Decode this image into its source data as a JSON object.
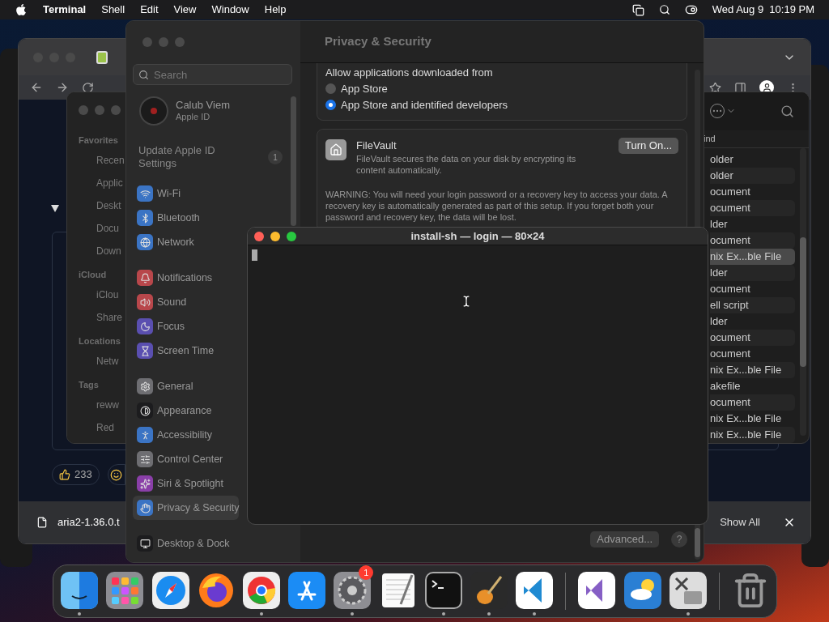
{
  "menu_bar": {
    "app": "Terminal",
    "menus": [
      "Shell",
      "Edit",
      "View",
      "Window",
      "Help"
    ],
    "clock": "Wed Aug 9  10:19 PM"
  },
  "browser": {
    "reaction_count": "233",
    "download": {
      "file": "aria2-1.36.0.t",
      "show_all": "Show All"
    }
  },
  "finder": {
    "sidebar": [
      {
        "kind": "heading",
        "label": "Favorites"
      },
      {
        "kind": "item",
        "label": "Recen"
      },
      {
        "kind": "item",
        "label": "Applic"
      },
      {
        "kind": "item",
        "label": "Deskt"
      },
      {
        "kind": "item",
        "label": "Docu"
      },
      {
        "kind": "item",
        "label": "Down"
      },
      {
        "kind": "heading",
        "label": "iCloud"
      },
      {
        "kind": "item",
        "label": "iClou"
      },
      {
        "kind": "item",
        "label": "Share"
      },
      {
        "kind": "heading",
        "label": "Locations"
      },
      {
        "kind": "item",
        "label": "Netw"
      },
      {
        "kind": "heading",
        "label": "Tags"
      },
      {
        "kind": "item",
        "label": "reww"
      },
      {
        "kind": "item",
        "label": "Red"
      }
    ],
    "column_header": "ind",
    "rows": [
      {
        "text": "older",
        "selected": false
      },
      {
        "text": "older",
        "selected": false
      },
      {
        "text": "ocument",
        "selected": false
      },
      {
        "text": "ocument",
        "selected": false
      },
      {
        "text": "lder",
        "selected": false
      },
      {
        "text": "ocument",
        "selected": false
      },
      {
        "text": "nix Ex...ble File",
        "selected": true
      },
      {
        "text": "lder",
        "selected": false
      },
      {
        "text": "ocument",
        "selected": false
      },
      {
        "text": "ell script",
        "selected": false
      },
      {
        "text": "lder",
        "selected": false
      },
      {
        "text": "ocument",
        "selected": false
      },
      {
        "text": "ocument",
        "selected": false
      },
      {
        "text": "nix Ex...ble File",
        "selected": false
      },
      {
        "text": "akefile",
        "selected": false
      },
      {
        "text": "ocument",
        "selected": false
      },
      {
        "text": "nix Ex...ble File",
        "selected": false
      },
      {
        "text": "nix Ex...ble File",
        "selected": false
      }
    ]
  },
  "settings": {
    "search": {
      "placeholder": "Search"
    },
    "account": {
      "name": "Calub Viem",
      "subtitle": "Apple ID"
    },
    "update": {
      "label": "Update Apple ID Settings",
      "badge": "1"
    },
    "groups": [
      [
        {
          "label": "Wi-Fi",
          "color": "#3b74c4",
          "selected": false
        },
        {
          "label": "Bluetooth",
          "color": "#3b74c4",
          "selected": false
        },
        {
          "label": "Network",
          "color": "#3b74c4",
          "selected": false
        }
      ],
      [
        {
          "label": "Notifications",
          "color": "#b8474b",
          "selected": false
        },
        {
          "label": "Sound",
          "color": "#b8474b",
          "selected": false
        },
        {
          "label": "Focus",
          "color": "#5a4fb0",
          "selected": false
        },
        {
          "label": "Screen Time",
          "color": "#5a4fb0",
          "selected": false
        }
      ],
      [
        {
          "label": "General",
          "color": "#6e6e72",
          "selected": false
        },
        {
          "label": "Appearance",
          "color": "#1c1c1e",
          "selected": false
        },
        {
          "label": "Accessibility",
          "color": "#3b74c4",
          "selected": false
        },
        {
          "label": "Control Center",
          "color": "#6e6e72",
          "selected": false
        },
        {
          "label": "Siri & Spotlight",
          "color": "#8a3fa8",
          "selected": false
        },
        {
          "label": "Privacy & Security",
          "color": "#3b74c4",
          "selected": true
        }
      ],
      [
        {
          "label": "Desktop & Dock",
          "color": "#1c1c1e",
          "selected": false
        }
      ]
    ],
    "title": "Privacy & Security",
    "allow": {
      "heading": "Allow applications downloaded from",
      "options": [
        {
          "label": "App Store",
          "selected": false
        },
        {
          "label": "App Store and identified developers",
          "selected": true
        }
      ]
    },
    "filevault": {
      "title": "FileVault",
      "description": "FileVault secures the data on your disk by encrypting its content automatically.",
      "button": "Turn On...",
      "warning": "WARNING: You will need your login password or a recovery key to access your data. A recovery key is automatically generated as part of this setup. If you forget both your password and recovery key, the data will be lost."
    },
    "advanced": "Advanced...",
    "help": "?"
  },
  "terminal": {
    "title": "install-sh — login — 80×24"
  },
  "dock": {
    "apps": [
      {
        "running": true
      },
      {
        "running": false
      },
      {
        "running": false
      },
      {
        "running": false
      },
      {
        "running": true
      },
      {
        "running": false
      },
      {
        "running": true,
        "badge": "1"
      },
      {
        "running": false
      },
      {
        "running": true
      },
      {
        "running": true
      },
      {
        "running": true
      },
      {
        "running": false
      },
      {
        "running": false
      },
      {
        "running": true
      }
    ],
    "trash": {
      "running": false
    }
  }
}
